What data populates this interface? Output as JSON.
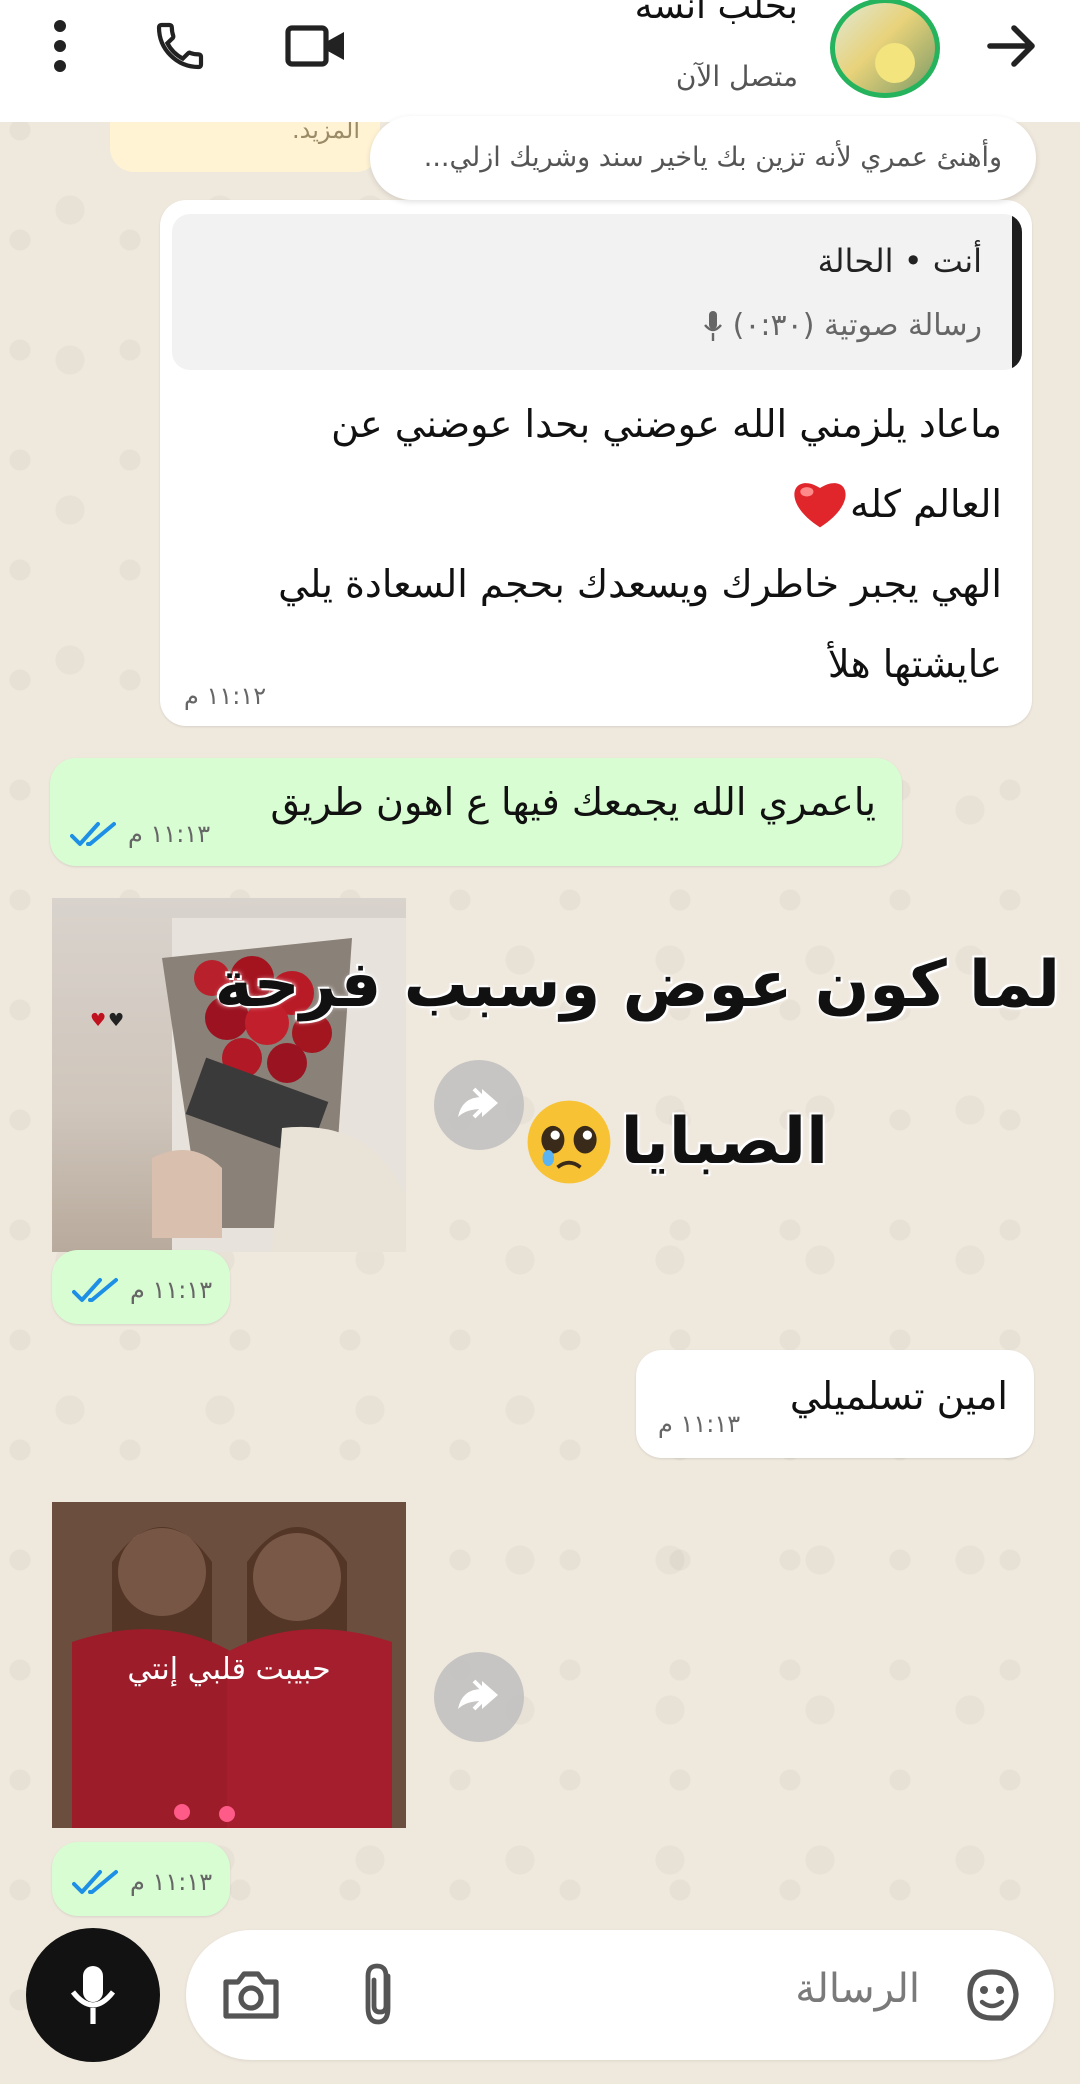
{
  "header": {
    "contact_name": "بحلب انسه",
    "contact_status": "متصل الآن",
    "menu_icon": "more-vert-icon",
    "call_icon": "phone-icon",
    "video_icon": "video-icon",
    "back_icon": "arrow-forward-icon"
  },
  "status_preview": {
    "peek_text": "المزيد.",
    "text": "وأهنئ عمري لأنه تزين بك ياخير سند وشريك ازلي..."
  },
  "messages": {
    "incoming_1": {
      "quote_author": "أنت • الحالة",
      "quote_voice": "رسالة صوتية (٠:٣٠)",
      "line1": "ماعاد يلزمني الله عوضني بحدا عوضني عن",
      "line2": "العالم كله",
      "line3": "الهي يجبر خاطرك ويسعدك بحجم السعادة يلي",
      "line4": "عايشتها هلأ",
      "time": "١١:١٢ م"
    },
    "outgoing_1": {
      "text": "ياعمري الله يجمعك فيها ع اهون طريق",
      "time": "١١:١٣ م"
    },
    "image_1": {
      "overlay_line1": "لما كون عوض وسبب فرحة",
      "overlay_line2": "الصبايا",
      "time": "١١:١٣ م"
    },
    "incoming_2": {
      "text": "امين تسلميلي",
      "time": "١١:١٣ م"
    },
    "image_2": {
      "caption": "حبيبت قلبي إنتي",
      "time": "١١:١٣ م"
    }
  },
  "composer": {
    "placeholder": "الرسالة",
    "emoji_icon": "sticker-icon",
    "attach_icon": "paperclip-icon",
    "camera_icon": "camera-icon",
    "mic_icon": "mic-icon"
  },
  "colors": {
    "outgoing_bubble": "#d8fdd2",
    "incoming_bubble": "#ffffff",
    "read_ticks": "#1d8fe6",
    "avatar_ring": "#25b35d",
    "wallpaper": "#efe8dd"
  }
}
